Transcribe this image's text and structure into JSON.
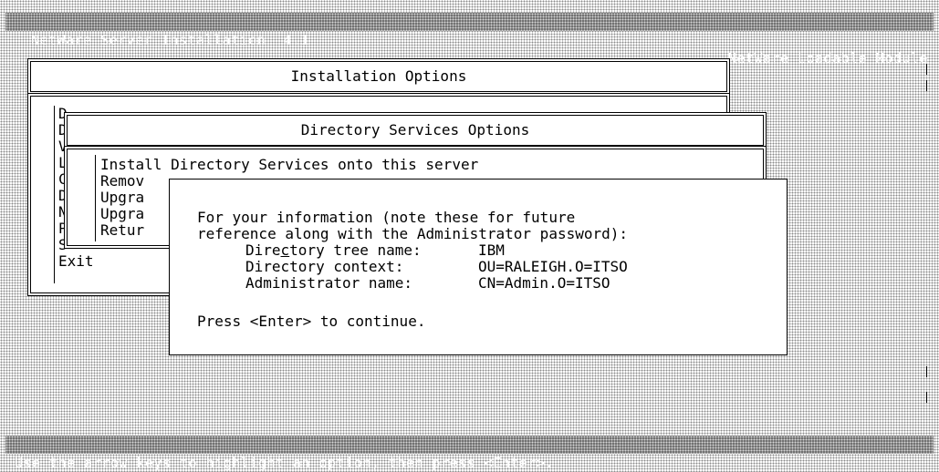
{
  "title_bar": {
    "app_title": "NetWare Server Installation  4.1",
    "module_label": "NetWare Loadable Module"
  },
  "installation_options": {
    "title": "Installation Options",
    "item_letters": [
      "D",
      "D",
      "V",
      "L",
      "C",
      "D",
      "N",
      "P",
      "S"
    ],
    "exit_label": "Exit"
  },
  "directory_services_options": {
    "title": "Directory Services Options",
    "options": [
      "Install Directory Services onto this server",
      "Remov",
      "Upgra",
      "Upgra",
      "Retur"
    ]
  },
  "info_dialog": {
    "intro_line1": "For your information (note these for future",
    "intro_line2": "reference along with the Administrator password):",
    "tree_label_pre": "Dire",
    "tree_label_ul": "c",
    "tree_label_post": "tory tree name:",
    "tree_value": "IBM",
    "context_label": "Directory context:",
    "context_value": "OU=RALEIGH.O=ITSO",
    "admin_label": "Administrator name:",
    "admin_value": "CN=Admin.O=ITSO",
    "continue_prompt": "Press <Enter> to continue."
  },
  "status_bar": {
    "hint": "Use the arrow keys to highlight an option, then press <Enter>."
  }
}
